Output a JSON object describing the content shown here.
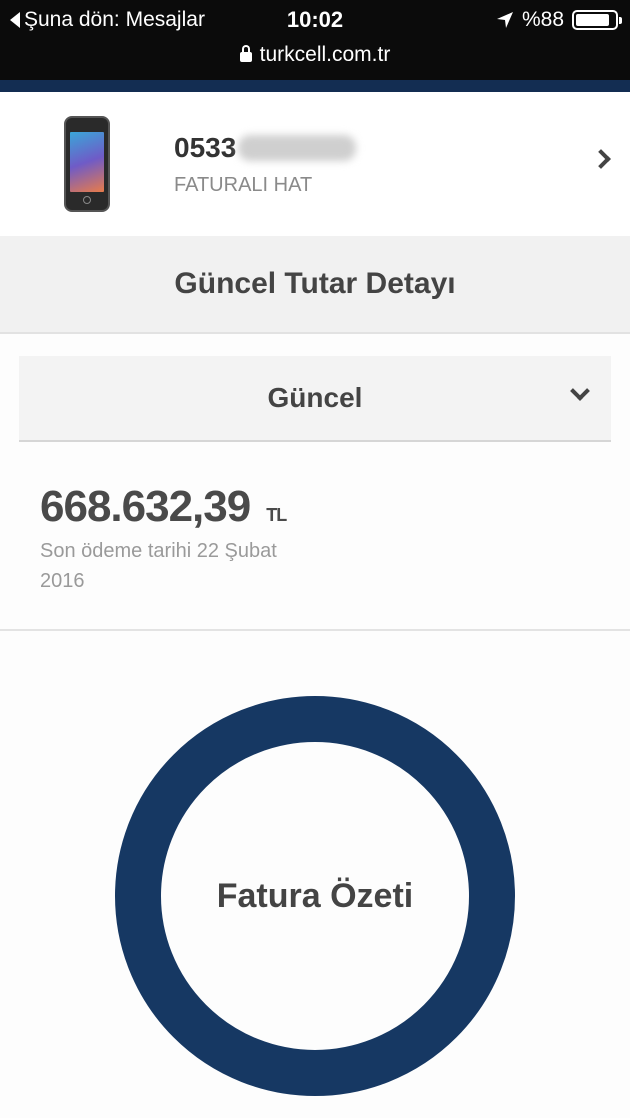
{
  "status_bar": {
    "back_label": "Şuna dön: Mesajlar",
    "time": "10:02",
    "battery": "%88",
    "battery_level": 0.88,
    "url": "turkcell.com.tr"
  },
  "line": {
    "number_visible": "0533",
    "type": "FATURALI HAT"
  },
  "section": {
    "title": "Güncel Tutar Detayı"
  },
  "period": {
    "selected": "Güncel"
  },
  "bill": {
    "amount": "668.632,39",
    "currency": "TL",
    "due_text": "Son ödeme tarihi 22 Şubat 2016"
  },
  "summary": {
    "label": "Fatura Özeti"
  },
  "colors": {
    "brand_navy": "#163863",
    "status_bar_bg": "#0b0b0b"
  }
}
